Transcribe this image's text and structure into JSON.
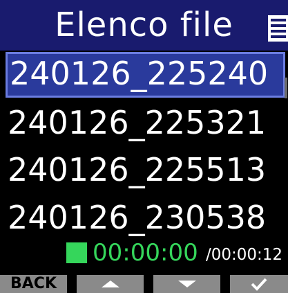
{
  "header": {
    "title": "Elenco file",
    "icon": "file-list-icon"
  },
  "files": [
    {
      "name": "240126_225240",
      "selected": true
    },
    {
      "name": "240126_225321",
      "selected": false
    },
    {
      "name": "240126_225513",
      "selected": false
    },
    {
      "name": "240126_230538",
      "selected": false
    }
  ],
  "playback": {
    "current": "00:00:00",
    "total": "/00:00:12",
    "indicator_color": "#35d65b"
  },
  "footer": {
    "back_label": "BACK",
    "up_icon": "triangle-up-icon",
    "down_icon": "triangle-down-icon",
    "confirm_icon": "checkmark-icon"
  },
  "colors": {
    "header_bg": "#191b6e",
    "selected_bg": "#2a3a9c",
    "selected_border": "#6b7de0",
    "footer_button": "#8a8a8a"
  }
}
